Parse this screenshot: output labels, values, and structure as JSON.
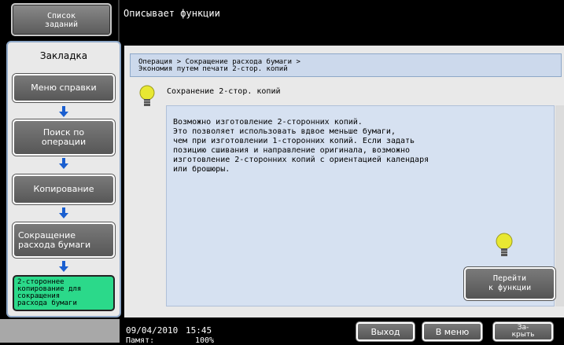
{
  "header": {
    "job_list_line1": "Список",
    "job_list_line2": "заданий",
    "function_description": "Описывает функции"
  },
  "sidebar": {
    "bookmark_label": "Закладка",
    "items": [
      {
        "label": "Меню справки"
      },
      {
        "label_line1": "Поиск по",
        "label_line2": "операции"
      },
      {
        "label": "Копирование"
      },
      {
        "label_line1": "Сокращение",
        "label_line2": "расхода бумаги"
      },
      {
        "label_line1": "2-стороннее",
        "label_line2": "копирование для",
        "label_line3": "сокращения",
        "label_line4": "расхода бумаги"
      }
    ]
  },
  "main": {
    "breadcrumb_line1": "Операция > Сокращение расхода бумаги >",
    "breadcrumb_line2": "Экономия путем печати 2-стор. копий",
    "section_title": "Сохранение  2-стор. копий",
    "description_lines": [
      "Возможно изготовление 2-сторонних копий.",
      "Это позволяет использовать вдвое меньше бумаги,",
      "чем при изготовлении 1-сторонних копий. Если задать",
      "позицию сшивания и направление оригинала, возможно",
      "изготовление 2-сторонних копий с ориентацией календаря",
      "или брошюры."
    ],
    "goto_line1": "Перейти",
    "goto_line2": "к функции"
  },
  "footer": {
    "date": "09/04/2010",
    "time": "15:45",
    "toner_label": "Памят:",
    "toner_value": "100%",
    "exit_label": "Выход",
    "menu_label": "В меню",
    "close_line1": "За-",
    "close_line2": "крыть"
  },
  "colors": {
    "accent_active": "#2bd98a",
    "panel_blue": "#ccd9ec",
    "arrow_blue": "#1a5fd0"
  }
}
